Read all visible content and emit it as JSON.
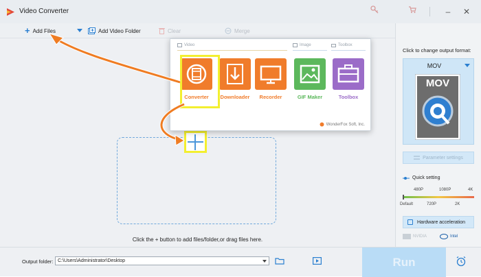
{
  "app": {
    "title": "Video Converter"
  },
  "titlebar": {
    "key_icon": "key-icon",
    "cart_icon": "cart-icon",
    "minimize_label": "–",
    "close_label": "✕"
  },
  "toolbar": {
    "add_files": "Add Files",
    "add_video_folder": "Add Video Folder",
    "clear": "Clear",
    "merge": "Merge"
  },
  "popup": {
    "sections": {
      "video": "Video",
      "image": "Image",
      "toolbox": "Toolbox"
    },
    "tiles": [
      {
        "label": "Converter",
        "color": "#f07c2b"
      },
      {
        "label": "Downloader",
        "color": "#f07c2b"
      },
      {
        "label": "Recorder",
        "color": "#f07c2b"
      },
      {
        "label": "GIF Maker",
        "color": "#5cb85c"
      },
      {
        "label": "Toolbox",
        "color": "#9b6cc8"
      }
    ],
    "brand": "WonderFox Soft, Inc."
  },
  "main": {
    "hint": "Click the + button to add files/folder,or drag files here."
  },
  "right_panel": {
    "caption": "Click to change output format:",
    "format": "MOV",
    "format_logo_text": "MOV",
    "parameter_settings": "Parameter settings",
    "quick_setting": "Quick setting",
    "scale_top": [
      "480P",
      "1080P",
      "4K"
    ],
    "scale_bottom": [
      "Default",
      "720P",
      "2K"
    ],
    "hw_accel": "Hardware acceleration",
    "nvidia": "NVIDIA",
    "intel": "Intel"
  },
  "bottom": {
    "output_label": "Output folder:",
    "output_path": "C:\\Users\\Administrator\\Desktop",
    "run": "Run"
  },
  "colors": {
    "accent": "#2a7fd0",
    "highlight": "#f3ef2f",
    "arrow": "#ef7c22"
  }
}
